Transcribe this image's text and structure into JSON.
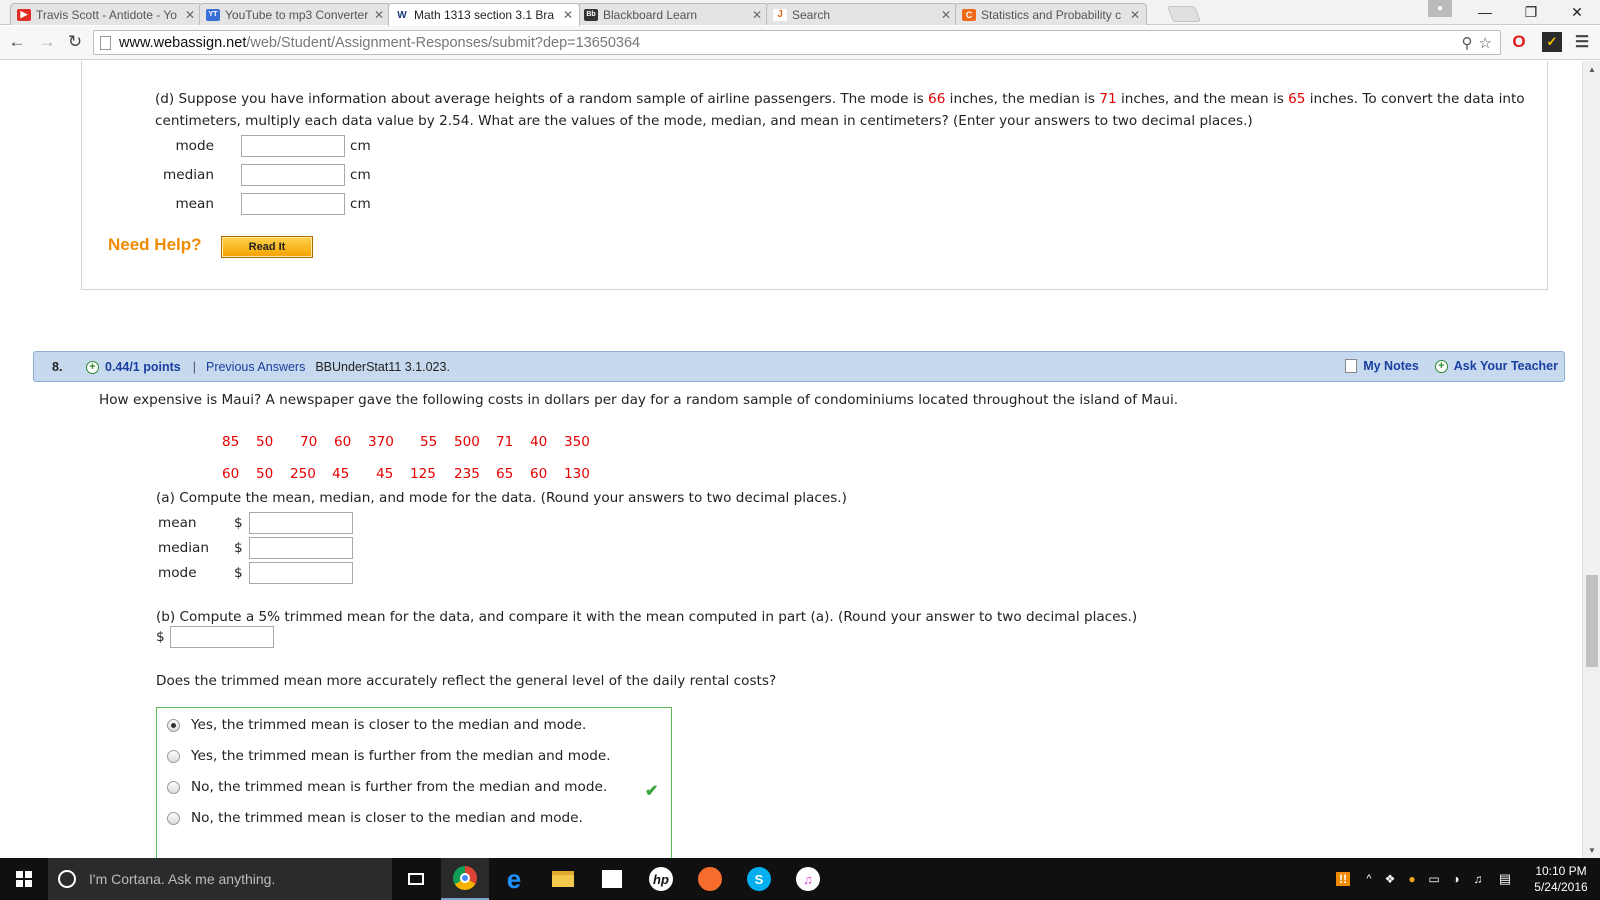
{
  "browser": {
    "tabs": [
      {
        "title": "Travis Scott - Antidote - Yo",
        "active": false,
        "icon": "youtube-icon"
      },
      {
        "title": "YouTube to mp3 Converter",
        "active": false,
        "icon": "yt-mp3-icon"
      },
      {
        "title": "Math 1313 section 3.1 Bra",
        "active": true,
        "icon": "webassign-icon"
      },
      {
        "title": "Blackboard Learn",
        "active": false,
        "icon": "blackboard-icon"
      },
      {
        "title": "Search",
        "active": false,
        "icon": "search-site-icon"
      },
      {
        "title": "Statistics and Probability c",
        "active": false,
        "icon": "chegg-icon"
      }
    ],
    "url_host": "www.webassign.net",
    "url_path": "/web/Student/Assignment-Responses/submit?dep=13650364"
  },
  "prev_question": {
    "part_d": {
      "t1": "(d) Suppose you have information about average heights of a random sample of airline passengers. The mode is ",
      "mode_val": "66",
      "t2": " inches, the median is ",
      "median_val": "71",
      "t3": " inches, and the mean is ",
      "mean_val": "65",
      "t4": " inches. To convert the data into centimeters, multiply each data value by 2.54. What are the values of the mode, median, and mean in centimeters? (Enter your answers to two decimal places.)"
    },
    "fields": [
      {
        "label": "mode",
        "unit": "cm"
      },
      {
        "label": "median",
        "unit": "cm"
      },
      {
        "label": "mean",
        "unit": "cm"
      }
    ],
    "need_help": "Need Help?",
    "read_it": "Read It"
  },
  "question8": {
    "number": "8.",
    "points": "0.44/1 points",
    "separator": "|",
    "previous_answers": "Previous Answers",
    "code": "BBUnderStat11 3.1.023.",
    "my_notes": "My Notes",
    "ask_teacher": "Ask Your Teacher",
    "prompt": "How expensive is Maui? A newspaper gave the following costs in dollars per day for a random sample of condominiums located throughout the island of Maui.",
    "data_row1": [
      "85",
      "50",
      "70",
      "60",
      "370",
      "55",
      "500",
      "71",
      "40",
      "350"
    ],
    "data_row2": [
      "60",
      "50",
      "250",
      "45",
      "45",
      "125",
      "235",
      "65",
      "60",
      "130"
    ],
    "part_a": "(a) Compute the mean, median, and mode for the data. (Round your answers to two decimal places.)",
    "a_fields": [
      {
        "label": "mean",
        "prefix": "$"
      },
      {
        "label": "median",
        "prefix": "$"
      },
      {
        "label": "mode",
        "prefix": "$"
      }
    ],
    "part_b": "(b) Compute a 5% trimmed mean for the data, and compare it with the mean computed in part (a). (Round your answer to two decimal places.)",
    "b_prefix": "$",
    "trim_question": "Does the trimmed mean more accurately reflect the general level of the daily rental costs?",
    "options": [
      {
        "label": "Yes, the trimmed mean is closer to the median and mode.",
        "selected": true
      },
      {
        "label": "Yes, the trimmed mean is further from the median and mode.",
        "selected": false
      },
      {
        "label": "No, the trimmed mean is further from the median and mode.",
        "selected": false
      },
      {
        "label": "No, the trimmed mean is closer to the median and mode.",
        "selected": false
      }
    ]
  },
  "taskbar": {
    "cortana": "I'm Cortana. Ask me anything.",
    "time": "10:10 PM",
    "date": "5/24/2016"
  },
  "colors": {
    "accent_red": "#e60000",
    "header_blue": "#c6d9ef",
    "help_orange": "#f08a00",
    "correct_green": "#3aa53a"
  }
}
